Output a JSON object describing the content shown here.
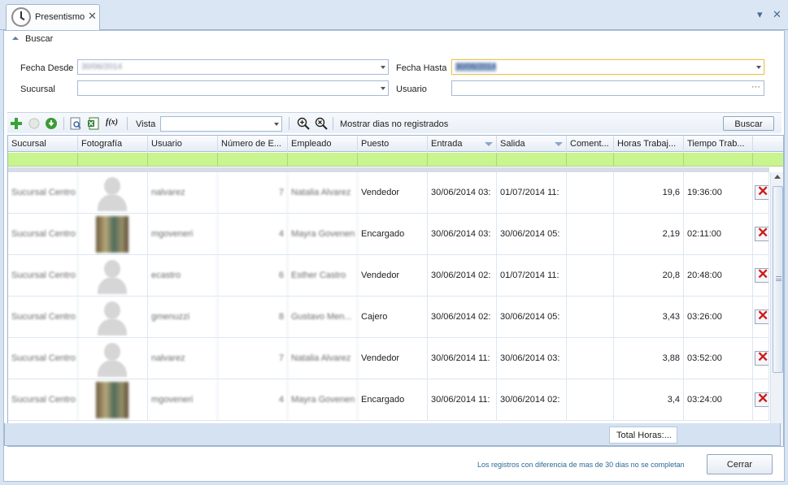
{
  "window": {
    "tab_label": "Presentismo",
    "tab_close": "✕",
    "menu_arrow": "▾",
    "window_close": "✕"
  },
  "search": {
    "section_title": "Buscar",
    "fecha_desde_label": "Fecha Desde",
    "fecha_desde_value": "30/06/2014",
    "fecha_hasta_label": "Fecha Hasta",
    "fecha_hasta_value": "30/06/2014",
    "sucursal_label": "Sucursal",
    "sucursal_value": "",
    "usuario_label": "Usuario",
    "usuario_value": "",
    "usuario_ellipsis": "···"
  },
  "toolbar": {
    "icons": [
      "add-icon",
      "disabled-circle-icon",
      "refresh-icon",
      "print-preview-icon",
      "excel-export-icon",
      "formula-icon",
      "zoom-in-icon",
      "zoom-clear-icon"
    ],
    "formula_text": "f(x)",
    "vista_label": "Vista",
    "vista_value": "",
    "mostrar_label": "Mostrar dias no registrados",
    "buscar_button": "Buscar"
  },
  "grid": {
    "columns": [
      "Sucursal",
      "Fotografía",
      "Usuario",
      "Número de E...",
      "Empleado",
      "Puesto",
      "Entrada",
      "Salida",
      "Coment...",
      "Horas Trabaj...",
      "Tiempo Trab..."
    ],
    "rows": [
      {
        "sucursal": "Sucursal Centro",
        "photo": "silhouette",
        "usuario": "nalvarez",
        "numero": "7",
        "empleado": "Natalia Alvarez",
        "puesto": "Vendedor",
        "entrada": "30/06/2014 03:",
        "salida": "01/07/2014 11:",
        "comentario": "",
        "horas": "19,6",
        "tiempo": "19:36:00"
      },
      {
        "sucursal": "Sucursal Centro",
        "photo": "picture",
        "usuario": "mgoveneri",
        "numero": "4",
        "empleado": "Mayra Govenen",
        "puesto": "Encargado",
        "entrada": "30/06/2014 03:",
        "salida": "30/06/2014 05:",
        "comentario": "",
        "horas": "2,19",
        "tiempo": "02:11:00"
      },
      {
        "sucursal": "Sucursal Centro",
        "photo": "silhouette",
        "usuario": "ecastro",
        "numero": "6",
        "empleado": "Esther Castro",
        "puesto": "Vendedor",
        "entrada": "30/06/2014 02:",
        "salida": "01/07/2014 11:",
        "comentario": "",
        "horas": "20,8",
        "tiempo": "20:48:00"
      },
      {
        "sucursal": "Sucursal Centro",
        "photo": "silhouette",
        "usuario": "gmenuzzi",
        "numero": "8",
        "empleado": "Gustavo Men...",
        "puesto": "Cajero",
        "entrada": "30/06/2014 02:",
        "salida": "30/06/2014 05:",
        "comentario": "",
        "horas": "3,43",
        "tiempo": "03:26:00"
      },
      {
        "sucursal": "Sucursal Centro",
        "photo": "silhouette",
        "usuario": "nalvarez",
        "numero": "7",
        "empleado": "Natalia Alvarez",
        "puesto": "Vendedor",
        "entrada": "30/06/2014 11:",
        "salida": "30/06/2014 03:",
        "comentario": "",
        "horas": "3,88",
        "tiempo": "03:52:00"
      },
      {
        "sucursal": "Sucursal Centro",
        "photo": "picture",
        "usuario": "mgoveneri",
        "numero": "4",
        "empleado": "Mayra Govenen",
        "puesto": "Encargado",
        "entrada": "30/06/2014 11:",
        "salida": "30/06/2014 02:",
        "comentario": "",
        "horas": "3,4",
        "tiempo": "03:24:00"
      }
    ],
    "delete_glyph": "✕",
    "total_label": "Total Horas:..."
  },
  "footer": {
    "note": "Los registros con diferencia de mas de 30 dias no se completan",
    "cerrar_button": "Cerrar"
  },
  "colors": {
    "filter_row": "#c8f58e",
    "delete_x": "#d01818",
    "note_text": "#2b6a96",
    "focus_border": "#e6c75c"
  }
}
